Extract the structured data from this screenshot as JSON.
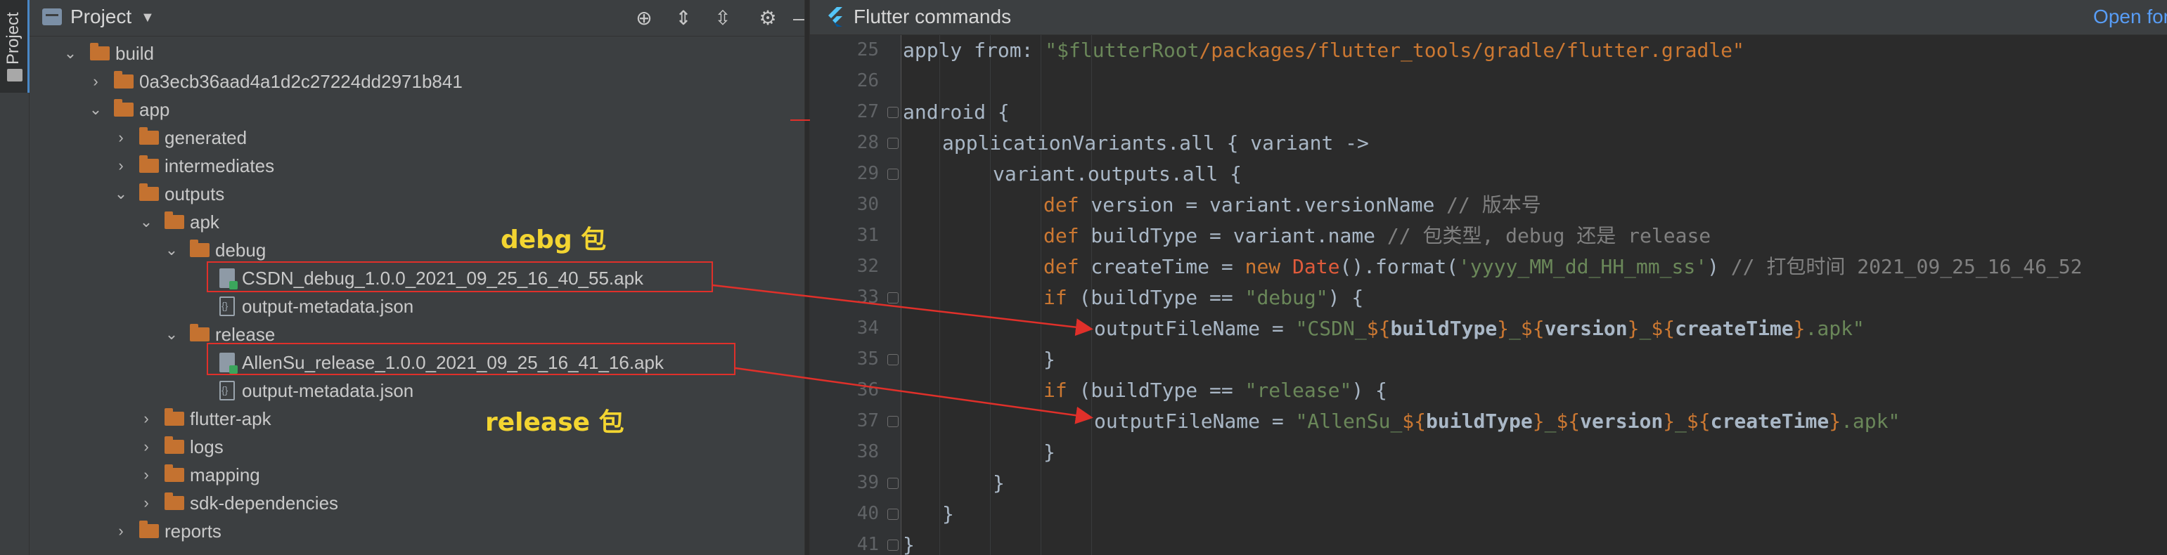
{
  "strip": {
    "tab_label": "Project"
  },
  "project_panel": {
    "title": "Project",
    "header_icons": [
      "locate-icon",
      "expand-all-icon",
      "collapse-all-icon",
      "gear-icon",
      "minimize-icon"
    ]
  },
  "tree": {
    "build": "build",
    "hash_dir": "0a3ecb36aad4a1d2c27224dd2971b841",
    "app": "app",
    "generated": "generated",
    "intermediates": "intermediates",
    "outputs": "outputs",
    "apk": "apk",
    "debug": "debug",
    "debug_apk": "CSDN_debug_1.0.0_2021_09_25_16_40_55.apk",
    "debug_meta": "output-metadata.json",
    "release": "release",
    "release_apk": "AllenSu_release_1.0.0_2021_09_25_16_41_16.apk",
    "release_meta": "output-metadata.json",
    "flutter_apk": "flutter-apk",
    "logs": "logs",
    "mapping": "mapping",
    "sdk_dependencies": "sdk-dependencies",
    "reports": "reports"
  },
  "annotations": {
    "debug_label": "debg 包",
    "release_label": "release 包"
  },
  "editor": {
    "banner_title": "Flutter commands",
    "banner_link": "Open for",
    "line_numbers": [
      "25",
      "26",
      "27",
      "28",
      "29",
      "30",
      "31",
      "32",
      "33",
      "34",
      "35",
      "36",
      "37",
      "38",
      "39",
      "40",
      "41"
    ],
    "code": {
      "l25_a": "apply from: ",
      "l25_b": "\"$flutterRoot",
      "l25_c": "/packages/flutter_tools/gradle/flutter.gradle\"",
      "l27": "android {",
      "l28": "applicationVariants.all { variant ->",
      "l29": "variant.outputs.all {",
      "l30_k": "def",
      "l30_a": " version = variant.versionName ",
      "l30_c": "// 版本号",
      "l31_k": "def",
      "l31_a": " buildType = variant.name ",
      "l31_c": "// 包类型, debug 还是 release",
      "l32_k": "def",
      "l32_a": " createTime = ",
      "l32_new": "new",
      "l32_date": " Date",
      "l32_b": "().format(",
      "l32_s": "'yyyy_MM_dd_HH_mm_ss'",
      "l32_e": ") ",
      "l32_c": "// 打包时间 2021_09_25_16_46_52",
      "l33_k": "if",
      "l33_a": " (buildType == ",
      "l33_s": "\"debug\"",
      "l33_e": ") {",
      "l34_a": "outputFileName = ",
      "l34_s1": "\"CSDN_",
      "l34_t1": "${",
      "l34_v1": "buildType",
      "l34_t2": "}",
      "l34_s2": "_",
      "l34_t3": "${",
      "l34_v2": "version",
      "l34_t4": "}",
      "l34_s3": "_",
      "l34_t5": "${",
      "l34_v3": "createTime",
      "l34_t6": "}",
      "l34_s4": ".apk\"",
      "l35": "}",
      "l36_k": "if",
      "l36_a": " (buildType == ",
      "l36_s": "\"release\"",
      "l36_e": ") {",
      "l37_a": "outputFileName = ",
      "l37_s1": "\"AllenSu_",
      "l37_s4": ".apk\"",
      "l38": "}",
      "l39": "}",
      "l40": "}",
      "l41": "}"
    }
  },
  "colors": {
    "highlight_box": "#e0302a",
    "annotation_text": "#f3d531",
    "keyword": "#cc7832",
    "string": "#6a8759",
    "comment": "#808080"
  }
}
